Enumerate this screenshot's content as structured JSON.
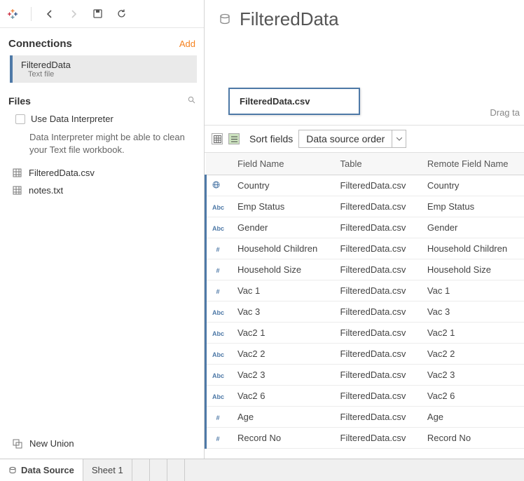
{
  "toolbar": {},
  "connections": {
    "title": "Connections",
    "add_label": "Add",
    "items": [
      {
        "name": "FilteredData",
        "type": "Text file"
      }
    ]
  },
  "files": {
    "title": "Files",
    "interpreter_label": "Use Data Interpreter",
    "interpreter_note": "Data Interpreter might be able to clean your Text file workbook.",
    "items": [
      {
        "name": "FilteredData.csv"
      },
      {
        "name": "notes.txt"
      }
    ]
  },
  "new_union_label": "New Union",
  "datasource": {
    "title": "FilteredData",
    "pill": "FilteredData.csv",
    "drag_hint": "Drag ta"
  },
  "grid_toolbar": {
    "sort_label": "Sort fields",
    "sort_value": "Data source order"
  },
  "grid": {
    "columns": [
      "Field Name",
      "Table",
      "Remote Field Name"
    ],
    "rows": [
      {
        "type": "geo",
        "field": "Country",
        "table": "FilteredData.csv",
        "remote": "Country"
      },
      {
        "type": "Abc",
        "field": "Emp Status",
        "table": "FilteredData.csv",
        "remote": "Emp Status"
      },
      {
        "type": "Abc",
        "field": "Gender",
        "table": "FilteredData.csv",
        "remote": "Gender"
      },
      {
        "type": "#",
        "field": "Household Children",
        "table": "FilteredData.csv",
        "remote": "Household Children"
      },
      {
        "type": "#",
        "field": "Household Size",
        "table": "FilteredData.csv",
        "remote": "Household Size"
      },
      {
        "type": "#",
        "field": "Vac 1",
        "table": "FilteredData.csv",
        "remote": "Vac 1"
      },
      {
        "type": "Abc",
        "field": "Vac 3",
        "table": "FilteredData.csv",
        "remote": "Vac 3"
      },
      {
        "type": "Abc",
        "field": "Vac2 1",
        "table": "FilteredData.csv",
        "remote": "Vac2 1"
      },
      {
        "type": "Abc",
        "field": "Vac2 2",
        "table": "FilteredData.csv",
        "remote": "Vac2 2"
      },
      {
        "type": "Abc",
        "field": "Vac2 3",
        "table": "FilteredData.csv",
        "remote": "Vac2 3"
      },
      {
        "type": "Abc",
        "field": "Vac2 6",
        "table": "FilteredData.csv",
        "remote": "Vac2 6"
      },
      {
        "type": "#",
        "field": "Age",
        "table": "FilteredData.csv",
        "remote": "Age"
      },
      {
        "type": "#",
        "field": "Record No",
        "table": "FilteredData.csv",
        "remote": "Record No"
      }
    ]
  },
  "tabs": {
    "datasource_label": "Data Source",
    "sheet_label": "Sheet 1"
  }
}
